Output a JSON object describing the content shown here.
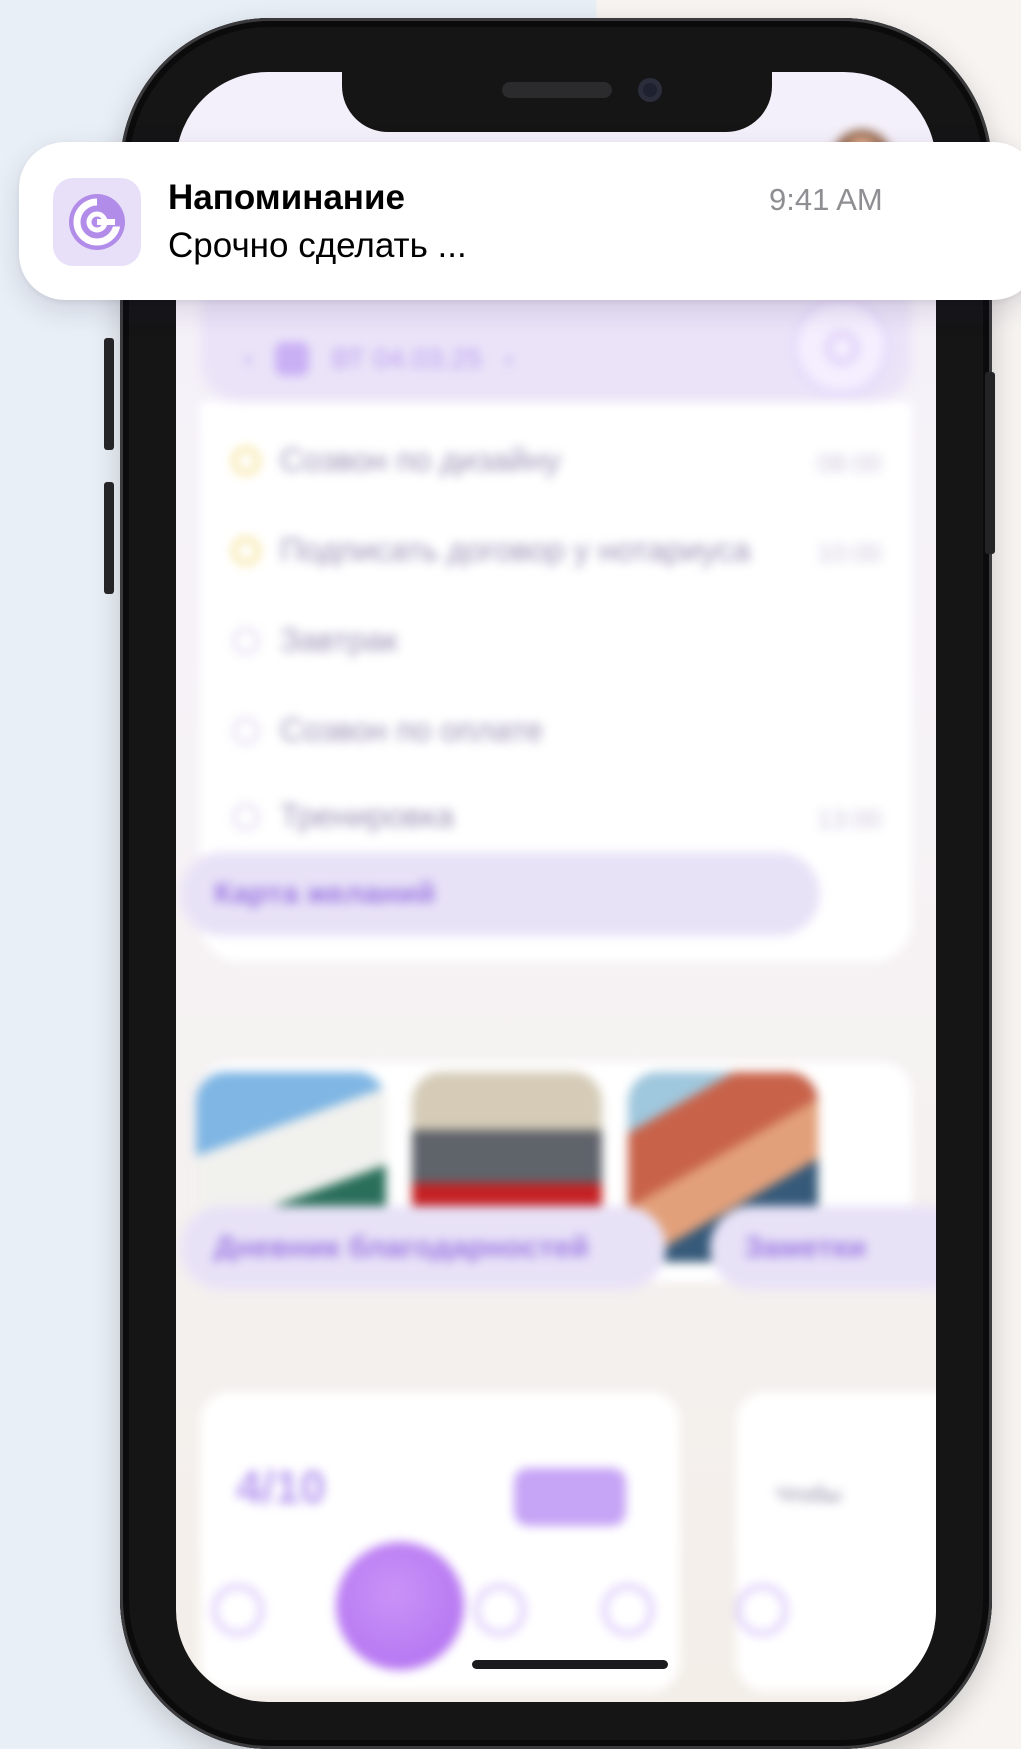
{
  "notification": {
    "app_icon": "app-logo-icon",
    "title": "Напоминание",
    "body": "Срочно сделать ...",
    "time": "9:41 AM"
  },
  "app": {
    "date_selector": {
      "prev_icon": "chevron-left-icon",
      "calendar_icon": "calendar-icon",
      "date": "ВТ 04.03.25",
      "next_icon": "chevron-right-icon",
      "focus_icon": "target-icon"
    },
    "tasks": [
      {
        "title": "Созвон по дизайну",
        "time": "08:00",
        "status": "yellow"
      },
      {
        "title": "Подписать договор у нотариуса",
        "time": "10:00",
        "status": "yellow"
      },
      {
        "title": "Завтрак",
        "time": "",
        "status": "none"
      },
      {
        "title": "Созвон по оплате",
        "time": "",
        "status": "none"
      },
      {
        "title": "Тренировка",
        "time": "13:00",
        "status": "none"
      }
    ],
    "wishes": {
      "title": "Карта желаний",
      "photos": [
        "house-photo",
        "car-photo",
        "coastline-photo"
      ]
    },
    "gratitude": {
      "title": "Дневник благодарностей",
      "counter": "4/10"
    },
    "notes": {
      "title": "Заметки",
      "preview": "Чтобы"
    },
    "tabbar": [
      "home-icon",
      "calendar-icon",
      "app-logo-icon",
      "heart-icon",
      "profile-icon"
    ]
  },
  "colors": {
    "accent": "#b06df0",
    "pill": "#e8e2f7",
    "notification_bg": "#ffffff",
    "time_gray": "#8e8e93"
  }
}
